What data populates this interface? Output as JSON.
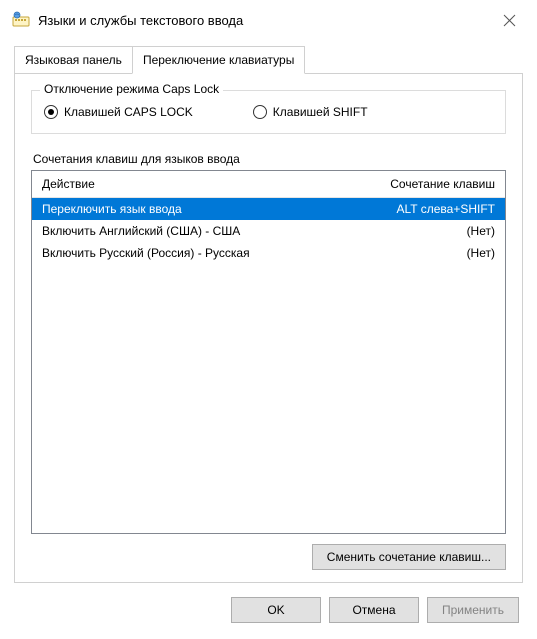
{
  "title": "Языки и службы текстового ввода",
  "tabs": {
    "language_bar": "Языковая панель",
    "switch_keyboard": "Переключение клавиатуры"
  },
  "capslock": {
    "legend": "Отключение режима Caps Lock",
    "by_capslock": "Клавишей CAPS LOCK",
    "by_shift": "Клавишей SHIFT"
  },
  "hotkeys": {
    "label": "Сочетания клавиш для языков ввода",
    "header_action": "Действие",
    "header_key": "Сочетание клавиш",
    "rows": [
      {
        "action": "Переключить язык ввода",
        "key": "ALT слева+SHIFT",
        "selected": true
      },
      {
        "action": "Включить Английский (США) - США",
        "key": "(Нет)",
        "selected": false
      },
      {
        "action": "Включить Русский (Россия) - Русская",
        "key": "(Нет)",
        "selected": false
      }
    ],
    "change_button": "Сменить сочетание клавиш..."
  },
  "footer": {
    "ok": "OK",
    "cancel": "Отмена",
    "apply": "Применить"
  }
}
